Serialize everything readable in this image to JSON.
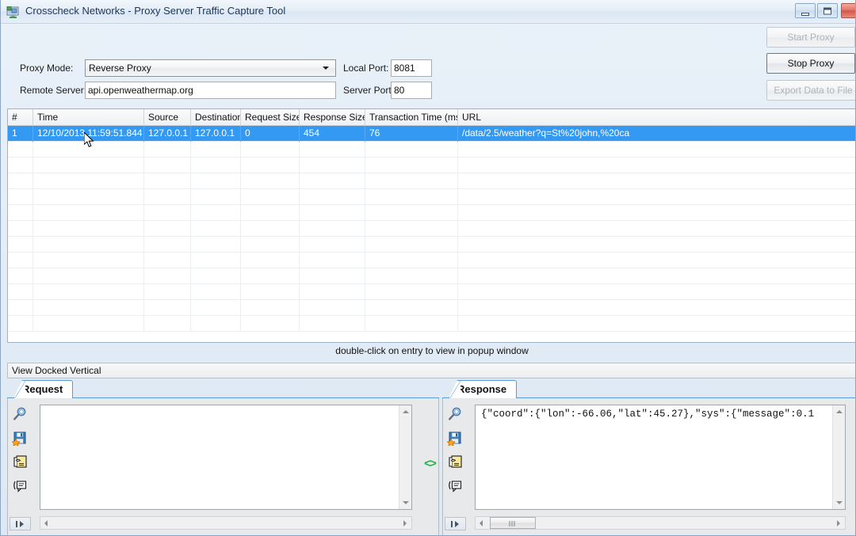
{
  "window": {
    "title": "Crosscheck Networks - Proxy Server Traffic Capture Tool",
    "icon": "proxy-monitor-icon",
    "controls": {
      "minimize": "minimize-icon",
      "maximize": "maximize-icon",
      "close": "close-icon"
    }
  },
  "config": {
    "proxy_mode_label": "Proxy Mode:",
    "proxy_mode_value": "Reverse Proxy",
    "remote_server_label": "Remote Server:",
    "remote_server_value": "api.openweathermap.org",
    "local_port_label": "Local Port:",
    "local_port_value": "8081",
    "server_port_label": "Server Port:",
    "server_port_value": "80"
  },
  "actions": {
    "start_proxy": "Start Proxy",
    "stop_proxy": "Stop Proxy",
    "export_data": "Export Data to File"
  },
  "grid": {
    "columns": [
      "#",
      "Time",
      "Source",
      "Destination",
      "Request Size",
      "Response Size",
      "Transaction Time (ms)",
      "URL"
    ],
    "rows": [
      {
        "num": "1",
        "time": "12/10/2013 11:59:51.844",
        "source": "127.0.0.1",
        "destination": "127.0.0.1",
        "request_size": "0",
        "response_size": "454",
        "transaction_time": "76",
        "url": "/data/2.5/weather?q=St%20john,%20ca"
      }
    ],
    "hint": "double-click on entry to view in popup window"
  },
  "dockbar": {
    "label": "View Docked Vertical"
  },
  "panels": {
    "request": {
      "tab_label": "Request",
      "content": "",
      "icons": [
        "search-icon",
        "save-icon",
        "copy-icon",
        "comment-icon"
      ]
    },
    "response": {
      "tab_label": "Response",
      "content": "{\"coord\":{\"lon\":-66.06,\"lat\":45.27},\"sys\":{\"message\":0.1",
      "icons": [
        "search-icon",
        "save-icon",
        "copy-icon",
        "comment-icon"
      ]
    }
  },
  "splitter": {
    "grip_label": "<>"
  },
  "colors": {
    "accent": "#3399f3",
    "tab_border": "#5b9bd5",
    "splitter_green": "#22b14c",
    "title_text": "#17365d"
  }
}
